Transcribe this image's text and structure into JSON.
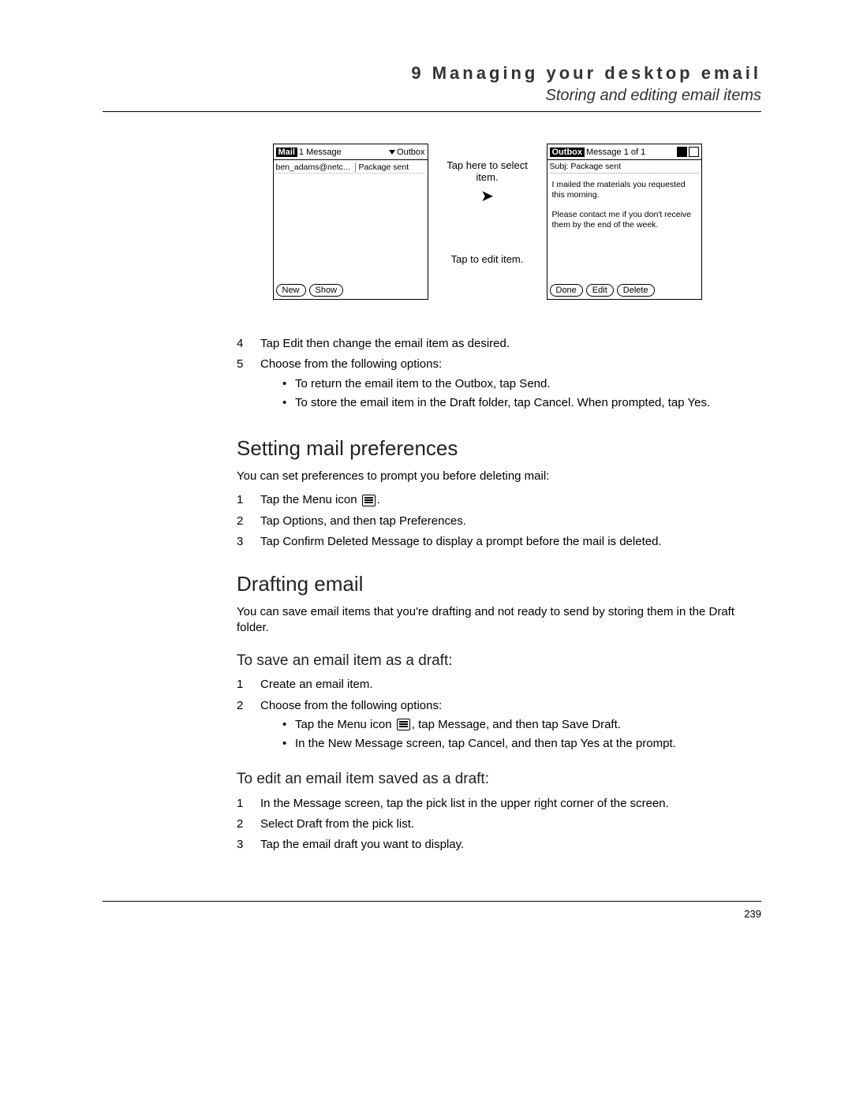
{
  "header": {
    "chapter": "9 Managing your desktop email",
    "section": "Storing and editing email items"
  },
  "figure": {
    "left": {
      "app_label": "Mail",
      "count": "1 Message",
      "dropdown": "Outbox",
      "row_from": "ben_adams@netc...",
      "row_subj": "Package sent",
      "btn_new": "New",
      "btn_show": "Show"
    },
    "callout1": "Tap here to select item.",
    "callout2": "Tap to edit item.",
    "right": {
      "app_label": "Outbox",
      "count": "Message 1 of 1",
      "subj_label": "Subj:",
      "subj": "Package sent",
      "body1": "I mailed the materials you requested this morning.",
      "body2": "Please contact me if you don't receive them by the end of the week.",
      "btn_done": "Done",
      "btn_edit": "Edit",
      "btn_delete": "Delete"
    }
  },
  "steps_a": {
    "s4": "Tap Edit then change the email item as desired.",
    "s5": "Choose from the following options:",
    "b1": "To return the email item to the Outbox, tap Send.",
    "b2": "To store the email item in the Draft folder, tap Cancel. When prompted, tap Yes."
  },
  "sec1": {
    "title": "Setting mail preferences",
    "intro": "You can set preferences to prompt you before deleting mail:",
    "s1a": "Tap the Menu icon ",
    "s1b": ".",
    "s2": "Tap Options, and then tap Preferences.",
    "s3": "Tap Confirm Deleted Message to display a prompt before the mail is deleted."
  },
  "sec2": {
    "title": "Drafting email",
    "intro": "You can save email items that you're drafting and not ready to send by storing them in the Draft folder.",
    "sub1": "To save an email item as a draft:",
    "s1": "Create an email item.",
    "s2": "Choose from the following options:",
    "b1a": "Tap the Menu icon ",
    "b1b": ", tap Message, and then tap Save Draft.",
    "b2": "In the New Message screen, tap Cancel, and then tap Yes at the prompt.",
    "sub2": "To edit an email item saved as a draft:",
    "e1": "In the Message screen, tap the pick list in the upper right corner of the screen.",
    "e2": "Select Draft from the pick list.",
    "e3": "Tap the email draft you want to display."
  },
  "page_number": "239"
}
